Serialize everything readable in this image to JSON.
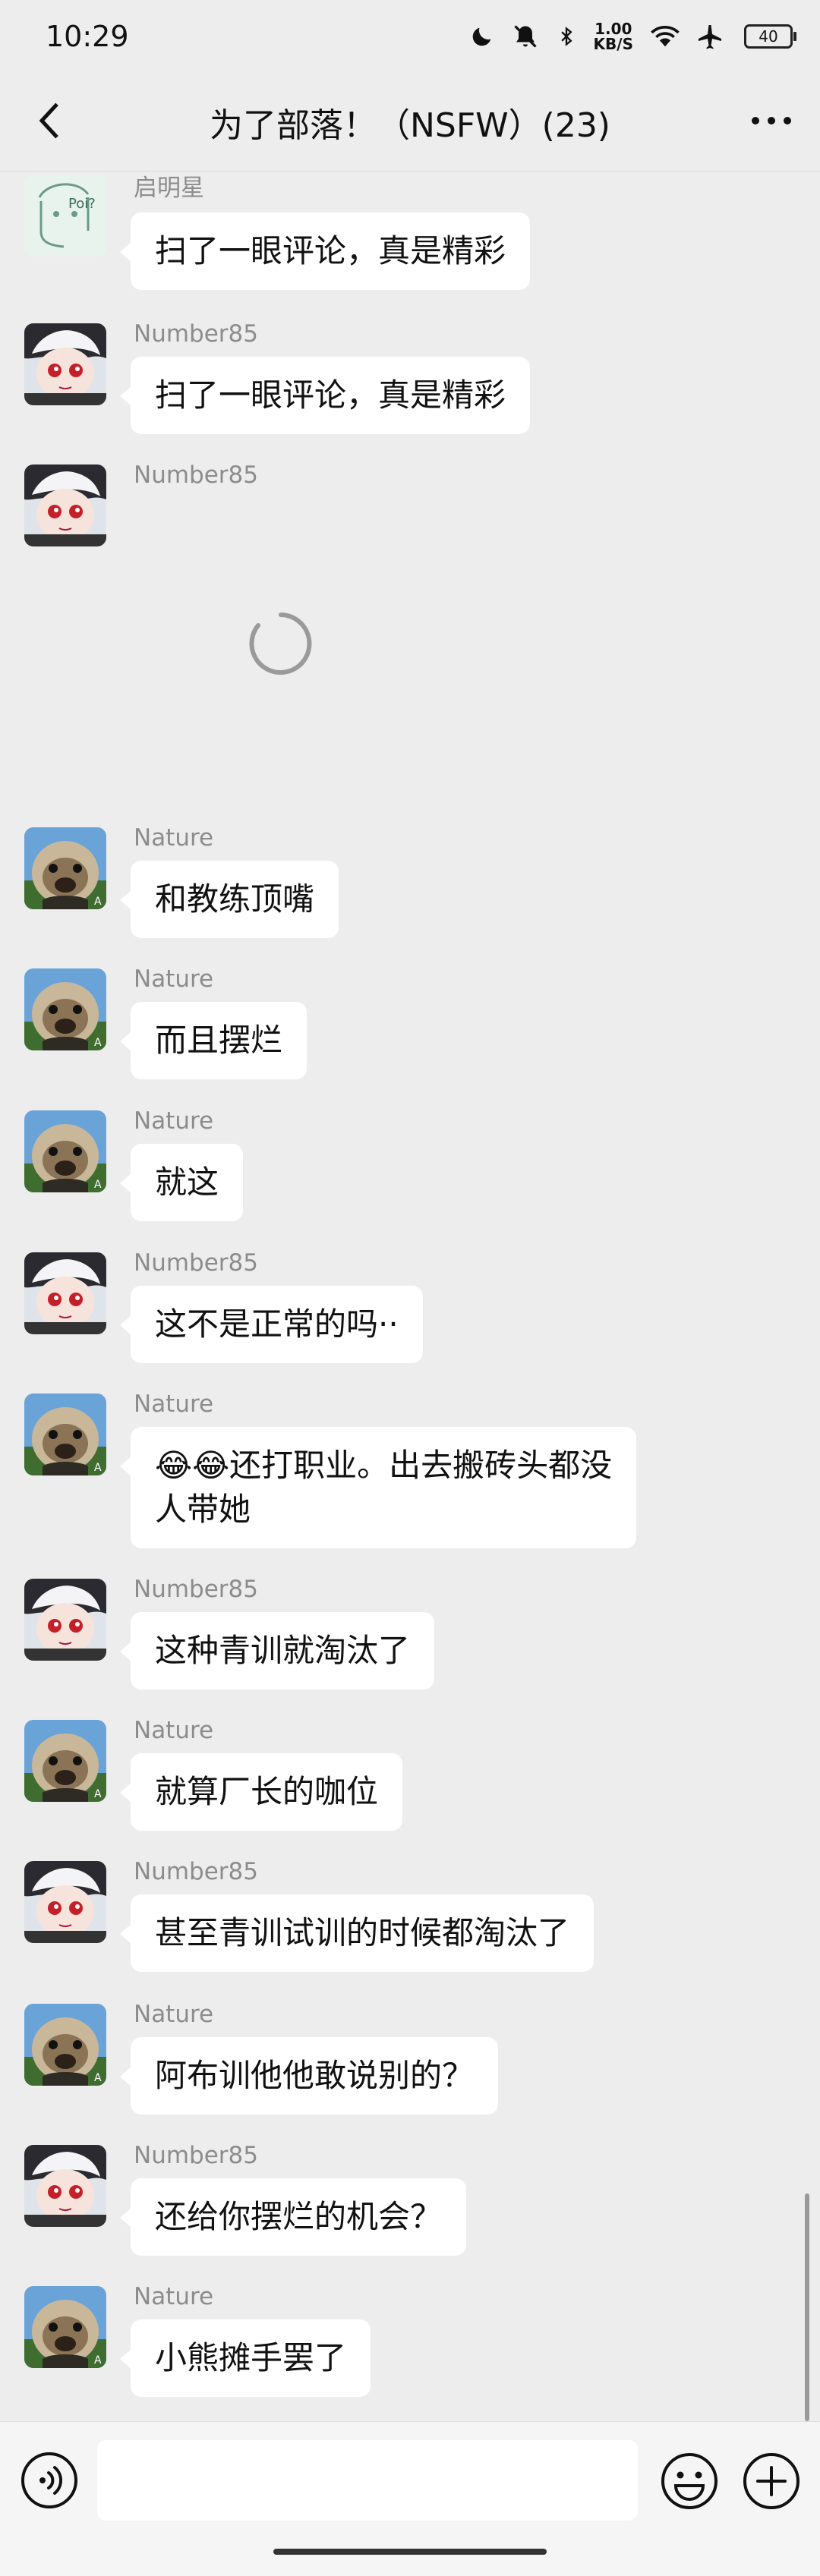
{
  "status_bar": {
    "time": "10:29",
    "net_speed_value": "1.00",
    "net_speed_unit": "KB/S",
    "battery": "40",
    "icons": [
      "moon-icon",
      "mute-bell-icon",
      "bluetooth-icon",
      "wifi-icon",
      "airplane-icon",
      "battery-icon"
    ]
  },
  "header": {
    "title": "为了部落！（NSFW）(23)",
    "back_icon": "chevron-left-icon",
    "more_icon": "more-horizontal-icon"
  },
  "messages": [
    {
      "sender": "启明星",
      "text": "扫了一眼评论，真是精彩",
      "avatar": "sketch"
    },
    {
      "sender": "Number85",
      "text": "扫了一眼评论，真是精彩",
      "avatar": "anime"
    },
    {
      "sender": "Number85",
      "text": "",
      "avatar": "anime",
      "loading": true
    },
    {
      "sender": "Nature",
      "text": "和教练顶嘴",
      "avatar": "ferret"
    },
    {
      "sender": "Nature",
      "text": "而且摆烂",
      "avatar": "ferret"
    },
    {
      "sender": "Nature",
      "text": "就这",
      "avatar": "ferret"
    },
    {
      "sender": "Number85",
      "text": "这不是正常的吗··",
      "avatar": "anime"
    },
    {
      "sender": "Nature",
      "text": "😂😂还打职业。出去搬砖头都没\n人带她",
      "avatar": "ferret"
    },
    {
      "sender": "Number85",
      "text": "这种青训就淘汰了",
      "avatar": "anime"
    },
    {
      "sender": "Nature",
      "text": "就算厂长的咖位",
      "avatar": "ferret"
    },
    {
      "sender": "Number85",
      "text": "甚至青训试训的时候都淘汰了",
      "avatar": "anime"
    },
    {
      "sender": "Nature",
      "text": "阿布训他他敢说别的？",
      "avatar": "ferret"
    },
    {
      "sender": "Number85",
      "text": "还给你摆烂的机会？",
      "avatar": "anime"
    },
    {
      "sender": "Nature",
      "text": "小熊摊手罢了",
      "avatar": "ferret"
    }
  ],
  "input_bar": {
    "voice_icon": "voice-icon",
    "input_placeholder": "",
    "emoji_icon": "emoji-icon",
    "plus_icon": "plus-circle-icon"
  }
}
